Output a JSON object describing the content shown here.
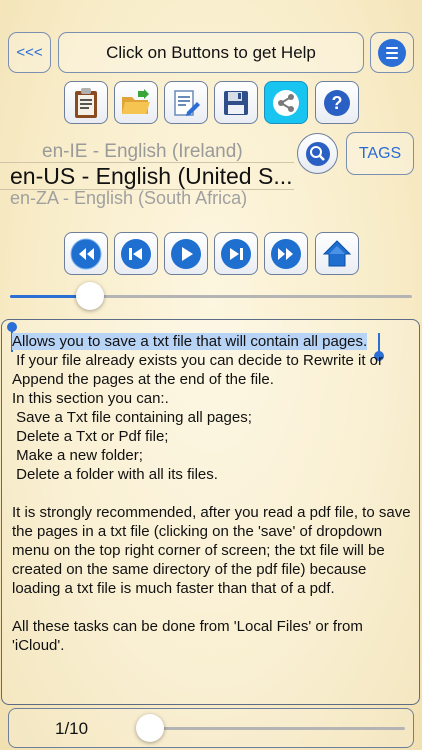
{
  "header": {
    "back_label": "<<<",
    "help_label": "Click on Buttons to get Help",
    "menu_icon": "menu-icon"
  },
  "toolbar": [
    {
      "name": "clipboard",
      "icon": "clipboard-icon",
      "active": false
    },
    {
      "name": "open-folder",
      "icon": "open-folder-icon",
      "active": false
    },
    {
      "name": "edit",
      "icon": "edit-document-icon",
      "active": false
    },
    {
      "name": "save",
      "icon": "save-disk-icon",
      "active": false
    },
    {
      "name": "share",
      "icon": "share-icon",
      "active": true
    },
    {
      "name": "help",
      "icon": "question-icon",
      "active": false
    }
  ],
  "language_picker": {
    "previous": "en-IE - English (Ireland)",
    "selected": "en-US - English (United S...",
    "next": "en-ZA - English (South Africa)"
  },
  "search_icon": "search-icon",
  "tags_label": "TAGS",
  "playback": [
    {
      "name": "rewind",
      "icon": "fast-backward-icon"
    },
    {
      "name": "previous",
      "icon": "skip-back-icon"
    },
    {
      "name": "play",
      "icon": "play-icon"
    },
    {
      "name": "next",
      "icon": "skip-forward-icon"
    },
    {
      "name": "fast-forward",
      "icon": "fast-forward-icon"
    },
    {
      "name": "home",
      "icon": "home-icon"
    }
  ],
  "speed_slider": {
    "value": 0.2
  },
  "help_text": {
    "highlighted": "Allows you to save a txt file that will contain all pages.",
    "lines": [
      " If your file already exists you can decide to Rewrite it or Append the pages at the end of the file.",
      "In this section you can:.",
      " Save a Txt file containing all pages;",
      " Delete a Txt or Pdf file;",
      " Make a new folder;",
      " Delete a folder with all its files.",
      "",
      "It is strongly recommended, after you read a pdf file, to save the pages in a txt file (clicking on the 'save' of dropdown menu on the top right corner of screen; the txt file will be created on the same directory of the pdf file) because loading a txt file is much faster than that of a pdf.",
      "",
      "All these tasks can be done from 'Local Files' or from 'iCloud'."
    ]
  },
  "pagination": {
    "label": "1/10",
    "current": 1,
    "total": 10
  },
  "colors": {
    "accent": "#2a6ed6",
    "active_tool": "#18c4f0"
  }
}
